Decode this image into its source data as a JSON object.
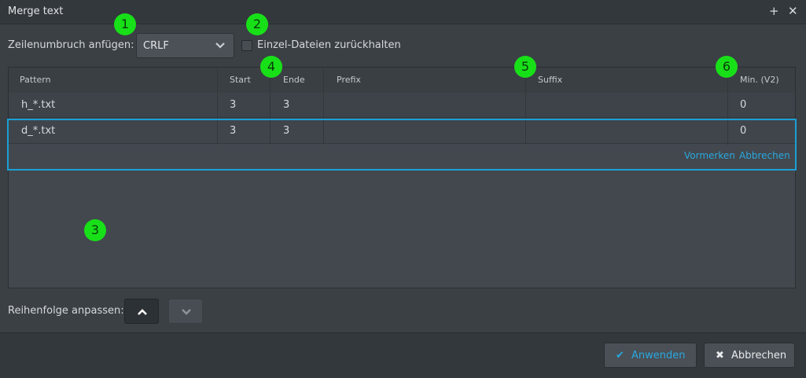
{
  "window": {
    "title": "Merge text",
    "plus_icon": "+",
    "close_icon": "✕"
  },
  "linebreak": {
    "label": "Zeilenumbruch anfügen:",
    "selected": "CRLF"
  },
  "hold_files": {
    "label": "Einzel-Dateien zurückhalten",
    "checked": false
  },
  "grid": {
    "columns": [
      "Pattern",
      "Start",
      "Ende",
      "Prefix",
      "Suffix",
      "Min. (V2)"
    ],
    "rows": [
      {
        "pattern": "h_*.txt",
        "start": "3",
        "ende": "3",
        "prefix": "",
        "suffix": "",
        "min": "0"
      },
      {
        "pattern": "d_*.txt",
        "start": "3",
        "ende": "3",
        "prefix": "",
        "suffix": "",
        "min": "0"
      }
    ],
    "row_actions": {
      "save": "Vormerken",
      "cancel": "Abbrechen"
    }
  },
  "order": {
    "label": "Reihenfolge anpassen:"
  },
  "footer": {
    "apply": "Anwenden",
    "cancel": "Abbrechen"
  },
  "markers": [
    "1",
    "2",
    "3",
    "4",
    "5",
    "6"
  ],
  "colors": {
    "accent": "#1aa0d6",
    "marker": "#18e018",
    "background": "#3b4045"
  }
}
